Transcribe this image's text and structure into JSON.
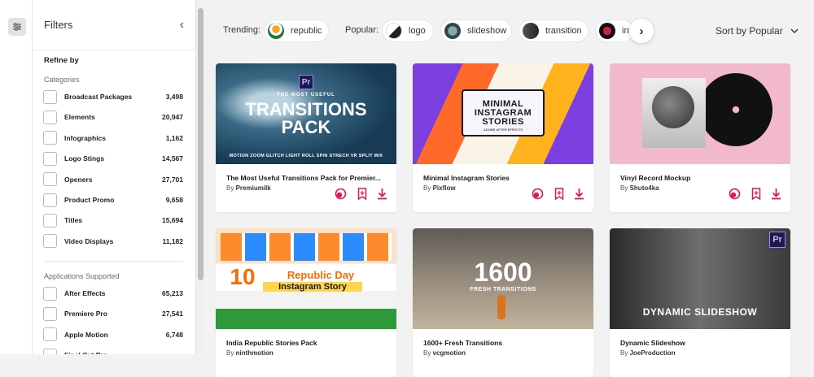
{
  "filters": {
    "title": "Filters",
    "collapse_icon": "chevron-left-icon",
    "refine_by": "Refine by",
    "categories": {
      "title": "Categories",
      "items": [
        {
          "label": "Broadcast Packages",
          "count": "3,498"
        },
        {
          "label": "Elements",
          "count": "20,947"
        },
        {
          "label": "Infographics",
          "count": "1,162"
        },
        {
          "label": "Logo Stings",
          "count": "14,567"
        },
        {
          "label": "Openers",
          "count": "27,701"
        },
        {
          "label": "Product Promo",
          "count": "9,658"
        },
        {
          "label": "Titles",
          "count": "15,694"
        },
        {
          "label": "Video Displays",
          "count": "11,182"
        }
      ]
    },
    "applications": {
      "title": "Applications Supported",
      "items": [
        {
          "label": "After Effects",
          "count": "65,213"
        },
        {
          "label": "Premiere Pro",
          "count": "27,541"
        },
        {
          "label": "Apple Motion",
          "count": "6,748"
        },
        {
          "label": "Final Cut Pro",
          "count": ""
        }
      ]
    }
  },
  "toolbar": {
    "trending_label": "Trending:",
    "trending": [
      {
        "label": "republic"
      }
    ],
    "popular_label": "Popular:",
    "popular": [
      {
        "label": "logo"
      },
      {
        "label": "slideshow"
      },
      {
        "label": "transition"
      },
      {
        "label": "intro"
      }
    ],
    "sort_label": "Sort by Popular"
  },
  "cards": [
    {
      "title": "The Most Useful Transitions Pack for Premier...",
      "by": "By",
      "author": "Premiumilk",
      "overlay": [
        "THE MOST USEFUL",
        "TRANSITIONS",
        "PACK",
        "MOTION ZOOM GLITCH LIGHT ROLL SPIN STRECH VR SPLIT MIX"
      ],
      "badge": "Pr"
    },
    {
      "title": "Minimal Instagram Stories",
      "by": "By",
      "author": "Pixflow",
      "overlay": [
        "MINIMAL",
        "INSTAGRAM",
        "STORIES",
        "ADOBE AFTER EFFECTS"
      ]
    },
    {
      "title": "Vinyl Record Mockup",
      "by": "By",
      "author": "Shuto4ka",
      "overlay": []
    },
    {
      "title": "India Republic Stories Pack",
      "by": "By",
      "author": "ninthmotion",
      "overlay": [
        "10",
        "Republic Day",
        "Instagram Story"
      ]
    },
    {
      "title": "1600+ Fresh Transitions",
      "by": "By",
      "author": "vcgmotion",
      "overlay": [
        "1600",
        "FRESH TRANSITIONS"
      ]
    },
    {
      "title": "Dynamic Slideshow",
      "by": "By",
      "author": "JoeProduction",
      "overlay": [
        "DYNAMIC SLIDESHOW"
      ],
      "badge": "Pr"
    }
  ],
  "colors": {
    "accent": "#e0184d",
    "sidebar_bg": "#ffffff",
    "page_bg": "#f2f2f2"
  }
}
